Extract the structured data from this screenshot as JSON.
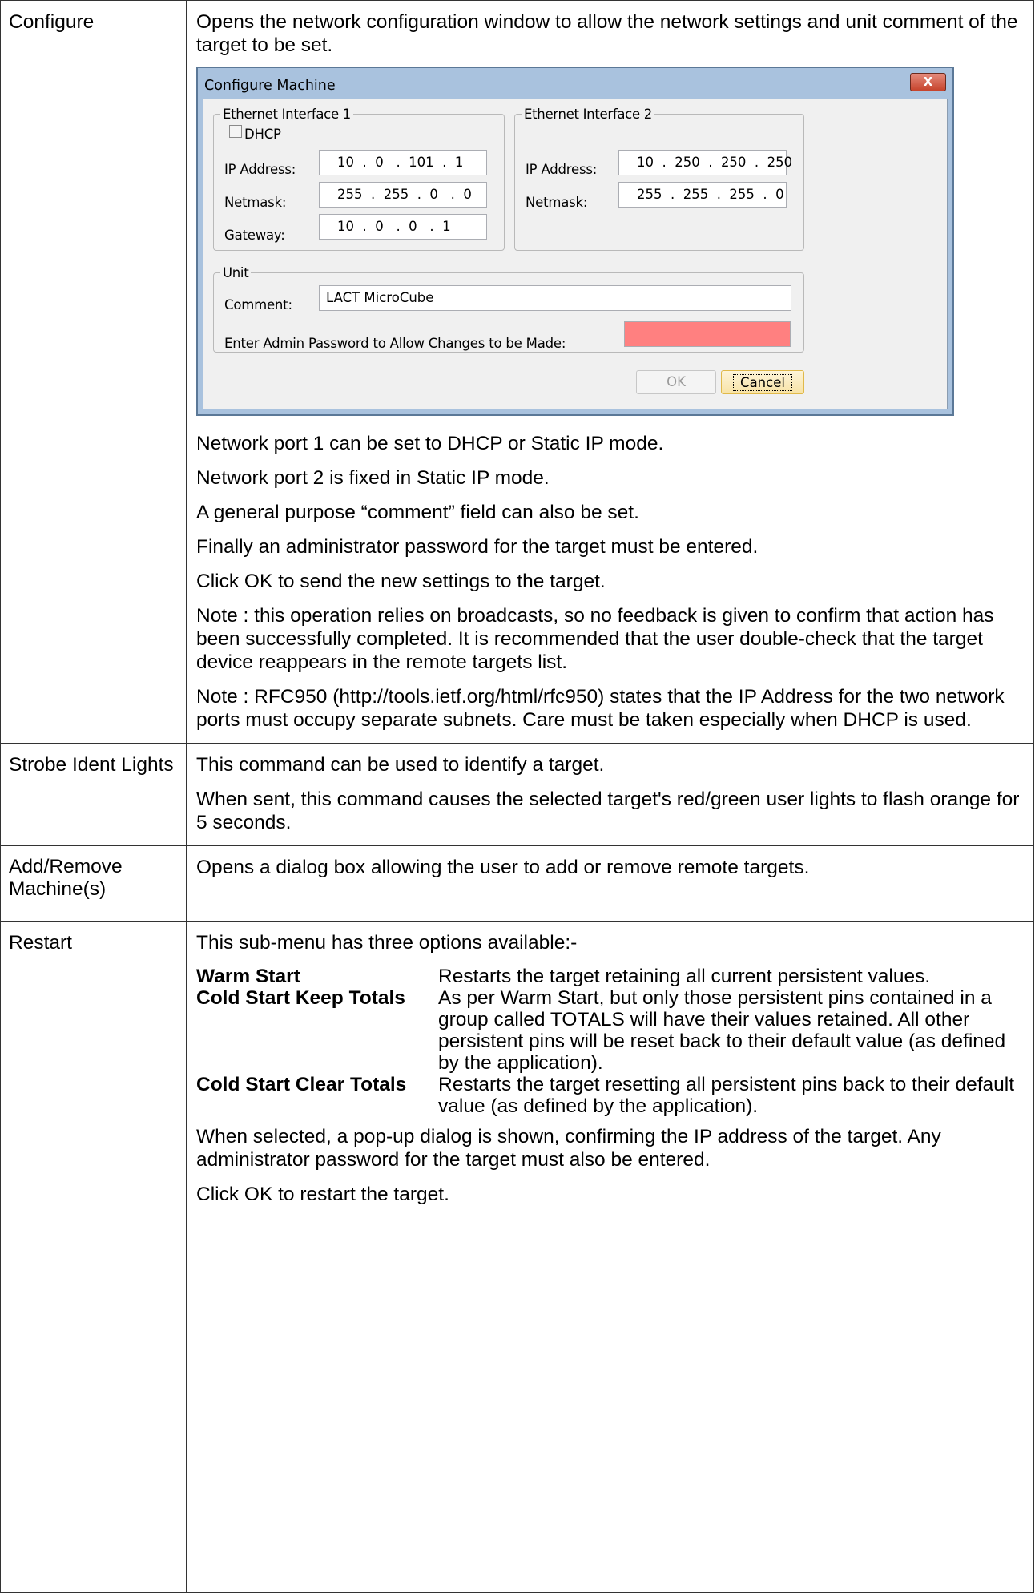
{
  "rows": {
    "configure": {
      "label": "Configure",
      "intro": "Opens the network configuration window to allow the network settings and unit comment of the target to be set.",
      "dialog": {
        "title": "Configure Machine",
        "close_glyph": "X",
        "eth1": {
          "legend": "Ethernet Interface 1",
          "dhcp_label": "DHCP",
          "dhcp_checked": false,
          "ip_label": "IP Address:",
          "ip_value": "10  .  0   .  101  .  1",
          "netmask_label": "Netmask:",
          "netmask_value": "255  .  255  .  0   .  0",
          "gateway_label": "Gateway:",
          "gateway_value": "10  .  0   .  0   .  1"
        },
        "eth2": {
          "legend": "Ethernet Interface 2",
          "ip_label": "IP Address:",
          "ip_value": "10  .  250  .  250  .  250",
          "netmask_label": "Netmask:",
          "netmask_value": "255  .  255  .  255  .  0"
        },
        "unit": {
          "legend": "Unit",
          "comment_label": "Comment:",
          "comment_value": "LACT MicroCube",
          "password_label": "Enter Admin Password to Allow Changes to be Made:",
          "password_value": "",
          "password_color": "#ff8080"
        },
        "ok_label": "OK",
        "cancel_label": "Cancel"
      },
      "paragraphs": [
        "Network port 1 can be set to DHCP or Static IP mode.",
        "Network port 2 is fixed in Static IP mode.",
        "A general purpose “comment” field can also be set.",
        "Finally an administrator password for the target must be entered.",
        "Click OK to send the new settings to the target.",
        "Note : this operation relies on broadcasts, so no feedback is given to confirm that action has been successfully completed. It is recommended that the user double-check that the target device reappears in the remote targets list.",
        "Note : RFC950 (http://tools.ietf.org/html/rfc950) states that the IP Address for the two network ports must occupy separate subnets. Care must be taken especially when DHCP is used."
      ]
    },
    "strobe": {
      "label": "Strobe Ident Lights",
      "paragraphs": [
        "This command can be used to identify a target.",
        "When sent, this command causes the selected target's red/green user lights to flash orange for 5 seconds."
      ]
    },
    "addremove": {
      "label": "Add/Remove Machine(s)",
      "paragraphs": [
        "Opens a dialog box allowing the user to add or remove remote targets."
      ]
    },
    "restart": {
      "label": "Restart",
      "intro": "This sub-menu has three options available:-",
      "options": [
        {
          "name": "Warm Start",
          "desc": "Restarts the target retaining all current persistent values."
        },
        {
          "name": "Cold Start Keep Totals",
          "desc": "As per Warm Start, but only those persistent pins contained in a group called TOTALS will have their values retained. All other persistent pins will be reset back to their default value (as defined by the application)."
        },
        {
          "name": "Cold Start Clear Totals",
          "desc": "Restarts the target resetting all persistent pins back to their default value (as defined by the application)."
        }
      ],
      "paragraphs": [
        "When selected, a pop-up dialog is shown, confirming the IP address of the target. Any administrator password for the target must also be entered.",
        "Click OK to restart the target."
      ]
    }
  }
}
